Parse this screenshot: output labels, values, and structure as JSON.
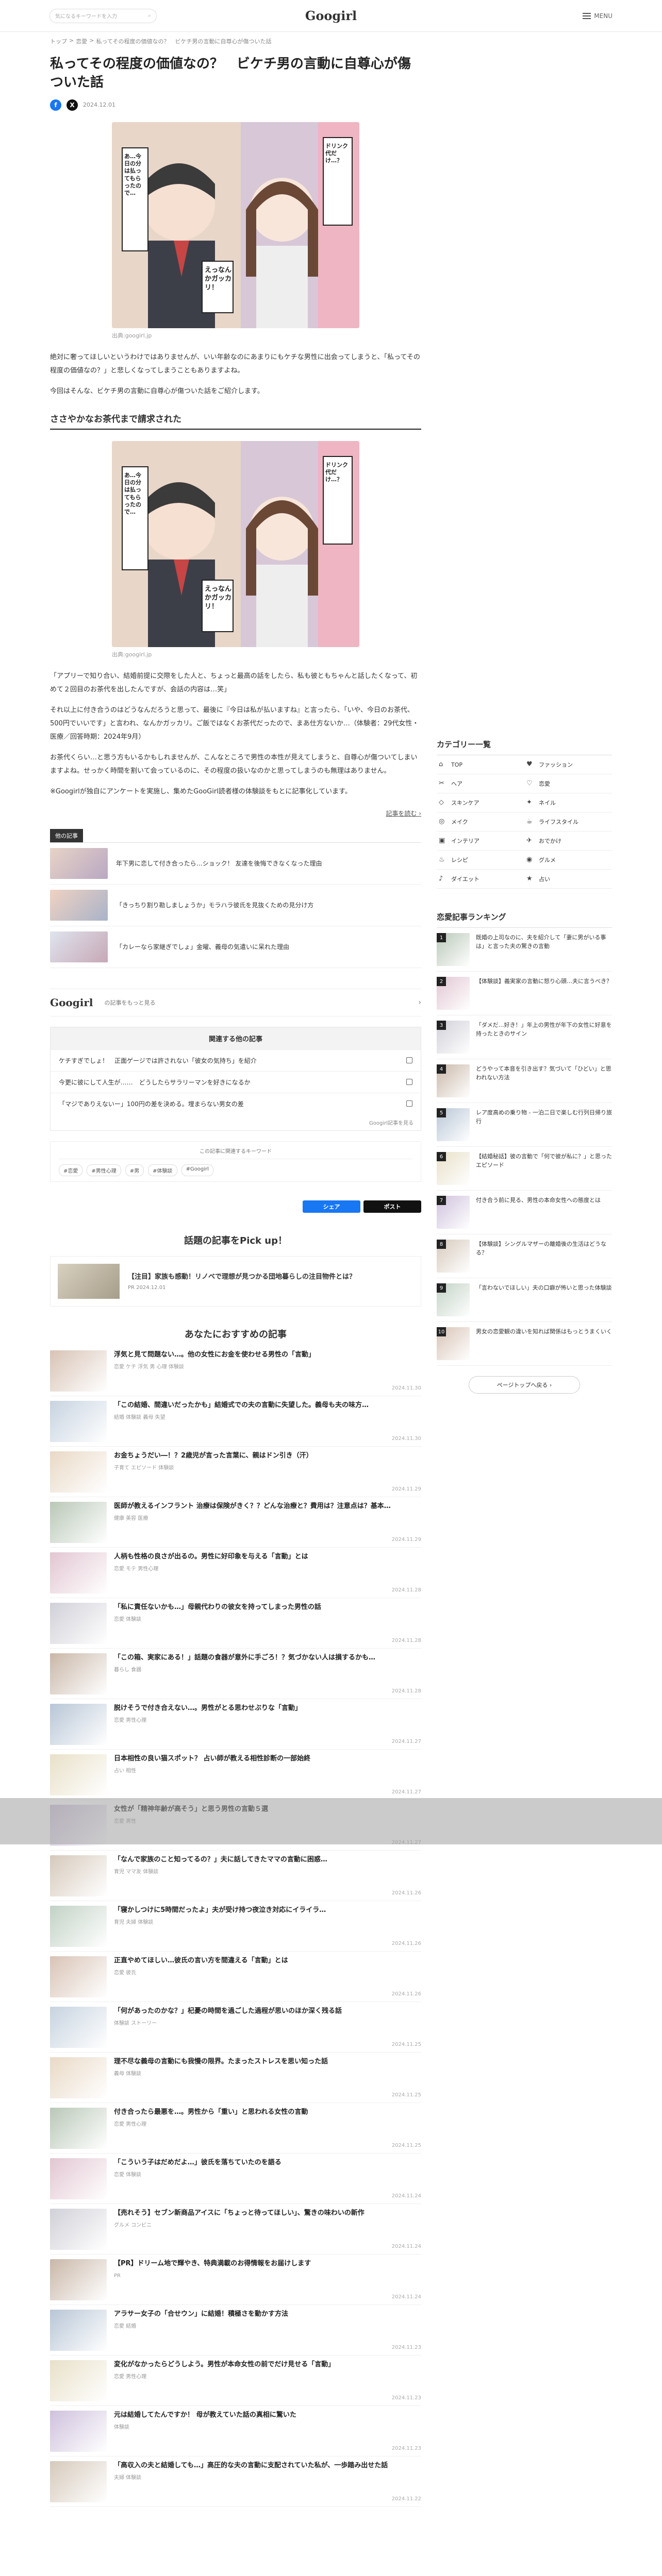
{
  "header": {
    "search_placeholder": "気になるキーワードを入力",
    "logo": "Googirl",
    "menu_label": "MENU"
  },
  "breadcrumb": [
    "トップ",
    ">",
    "恋愛",
    ">",
    "私ってその程度の価値なの？　ビケチ男の言動に自尊心が傷ついた話"
  ],
  "article": {
    "title": "私ってその程度の価値なの？　ビケチ男の言動に自尊心が傷ついた話",
    "date": "2024.12.01",
    "fb": "f",
    "x": "X",
    "image_caption": "出典:googirl.jp",
    "image_texts": [
      "あ…今日の分は払ってもらったので…",
      "えっなんかガッカリ！",
      "ドリンク代だけ…？"
    ],
    "intro": [
      "絶対に奢ってほしいというわけではありませんが、いい年齢なのにあまりにもケチな男性に出会ってしまうと、「私ってその程度の価値なの？」と悲しくなってしまうこともありますよね。",
      "今回はそんな、ビケチ男の言動に自尊心が傷ついた話をご紹介します。"
    ],
    "section_title": "ささやかなお茶代まで請求された",
    "section_caption": "出典:googirl.jp",
    "section_text": [
      "「アプリーで知り合い、結婚前提に交際をした人と、ちょっと最高の話をしたら、私も彼ともちゃんと話したくなって、初めて２回目のお茶代を出したんですが、会話の内容は…笑」",
      "それ以上に付き合うのはどうなんだろうと思って、最後に『今日は私が払いますね』と言ったら、「いや、今日のお茶代、500円でいいです」と言われ、なんかガッカリ。ご飯ではなくお茶代だったので、まあ仕方ないか…（体験者：29代女性・医療／回答時期：2024年9月）",
      "お茶代くらい…と思う方もいるかもしれませんが、こんなところで男性の本性が見えてしまうと、自尊心が傷ついてしまいますよね。せっかく時間を割いて会っているのに、その程度の扱いなのかと思ってしまうのも無理はありません。",
      "※Googirlが独自にアンケートを実施し、集めたGooGirl読者様の体験談をもとに記事化しています。"
    ],
    "source_link": "記事を読む ›",
    "related_head": "他の記事",
    "related": [
      "年下男に恋して付き合ったら…ショック！ 友達を後悔できなくなった理由",
      "「きっちり割り勘しましょうか」モラハラ彼氏を見抜くための見分け方",
      "「カレーなら家継ぎでしょ」金曜、義母の気遣いに呆れた理由"
    ]
  },
  "brand": {
    "logo": "Googirl",
    "text": "の記事をもっと見る",
    "arrow": "›"
  },
  "more": {
    "head": "関連する他の記事",
    "rows": [
      "ケチすぎでしょ！　正面ゲージでは許されない「彼女の気持ち」を紹介",
      "今更に彼にして人生が……　どうしたらサラリーマンを好きになるか",
      "「マジでありえないー」100円の差を決める。埋まらない男女の差"
    ],
    "foot": "Googirl記事を見る"
  },
  "tags": {
    "label": "この記事に関連するキーワード",
    "items": [
      "#恋愛",
      "#男性心理",
      "#男",
      "#体験談",
      "#Googirl"
    ]
  },
  "share": {
    "fb": "シェア",
    "x": "ポスト"
  },
  "pick": {
    "title": "話題の記事をPick up！",
    "card_title": "【注目】家族も感動！リノベで理想が見つかる団地暮らしの注目物件とは？",
    "card_date": "PR 2024.12.01"
  },
  "reco": {
    "title": "あなたにおすすめの記事",
    "items": [
      {
        "t": "浮気と見て問題ない…。他の女性にお金を使わせる男性の「言動」",
        "s": "恋愛 ケチ 浮気 男 心理 体験談",
        "d": "2024.11.30"
      },
      {
        "t": "「この結婚、間違いだったかも」結婚式での夫の言動に失望した。義母も夫の味方…",
        "s": "結婚 体験談 義母 失望",
        "d": "2024.11.30"
      },
      {
        "t": "お金ちょうだい―！？2歳児が言った言葉に、親はドン引き（汗）",
        "s": "子育て エピソード 体験談",
        "d": "2024.11.29"
      },
      {
        "t": "医師が教えるインフラント 治療は保険がきく？？どんな治療と？費用は？注意点は？基本…",
        "s": "健康 美容 医療",
        "d": "2024.11.29"
      },
      {
        "t": "人柄も性格の良さが出るの。男性に好印象を与える「言動」とは",
        "s": "恋愛 モテ 男性心理",
        "d": "2024.11.28"
      },
      {
        "t": "「私に責任ないかも…」母親代わりの彼女を持ってしまった男性の話",
        "s": "恋愛 体験談",
        "d": "2024.11.28"
      },
      {
        "t": "「この箱、実家にある！」話題の食器が意外に手ごろ！？気づかない人は損するかも…",
        "s": "暮らし 食器",
        "d": "2024.11.28"
      },
      {
        "t": "脱けそうで付き合えない…。男性がとる思わせぶりな「言動」",
        "s": "恋愛 男性心理",
        "d": "2024.11.27"
      },
      {
        "t": "日本相性の良い猫スポット？ 占い師が教える相性診断の一部始終",
        "s": "占い 相性",
        "d": "2024.11.27"
      },
      {
        "t": "女性が「精神年齢が高そう」と思う男性の言動５選",
        "s": "恋愛 男性",
        "d": "2024.11.27"
      },
      {
        "t": "「なんで家族のこと知ってるの？」夫に話してきたママの言動に困惑…",
        "s": "育児 ママ友 体験談",
        "d": "2024.11.26"
      },
      {
        "t": "「寝かしつけに5時間だったよ」夫が受け持つ夜泣き対応にイライラ…",
        "s": "育児 夫婦 体験談",
        "d": "2024.11.26"
      },
      {
        "t": "正直やめてほしい…彼氏の言い方を間違える「言動」とは",
        "s": "恋愛 彼氏",
        "d": "2024.11.26"
      },
      {
        "t": "「何があったのかな？」杞憂の時間を過ごした過程が思いのほか深く残る話",
        "s": "体験談 ストーリー",
        "d": "2024.11.25"
      },
      {
        "t": "理不尽な義母の言動にも我慢の限界。たまったストレスを思い知った話",
        "s": "義母 体験談",
        "d": "2024.11.25"
      },
      {
        "t": "付き合ったら最悪を…。男性から「重い」と思われる女性の言動",
        "s": "恋愛 男性心理",
        "d": "2024.11.25"
      },
      {
        "t": "「こういう子はだめだよ…」彼氏を落ちていたのを語る",
        "s": "恋愛 体験談",
        "d": "2024.11.24"
      },
      {
        "t": "【売れそう】セブン新商品アイスに「ちょっと待ってほしい」、驚きの味わいの新作",
        "s": "グルメ コンビニ",
        "d": "2024.11.24"
      },
      {
        "t": "【PR】ドリーム地で輝やき、特典満載のお得情報をお届けします",
        "s": "PR",
        "d": "2024.11.24"
      },
      {
        "t": "アラサー女子の「合せウン」に結婚！積極さを動かす方法",
        "s": "恋愛 結婚",
        "d": "2024.11.23"
      },
      {
        "t": "変化がなかったらどうしよう。男性が本命女性の前でだけ見せる「言動」",
        "s": "恋愛 男性心理",
        "d": "2024.11.23"
      },
      {
        "t": "元は結婚してたんですか！ 母が教えていた話の真相に驚いた",
        "s": "体験談",
        "d": "2024.11.23"
      },
      {
        "t": "「高収入の夫と結婚しても…」高圧的な夫の言動に支配されていた私が、一歩踏み出せた話",
        "s": "夫婦 体験談",
        "d": "2024.11.22"
      }
    ]
  },
  "sidebar": {
    "categories_title": "カテゴリー一覧",
    "categories": [
      {
        "label": "TOP",
        "icon": "⌂"
      },
      {
        "label": "ファッション",
        "icon": "♥"
      },
      {
        "label": "ヘア",
        "icon": "✂"
      },
      {
        "label": "恋愛",
        "icon": "♡"
      },
      {
        "label": "スキンケア",
        "icon": "◇"
      },
      {
        "label": "ネイル",
        "icon": "✦"
      },
      {
        "label": "メイク",
        "icon": "◎"
      },
      {
        "label": "ライフスタイル",
        "icon": "☕"
      },
      {
        "label": "インテリア",
        "icon": "▣"
      },
      {
        "label": "おでかけ",
        "icon": "✈"
      },
      {
        "label": "レシピ",
        "icon": "♨"
      },
      {
        "label": "グルメ",
        "icon": "◉"
      },
      {
        "label": "ダイエット",
        "icon": "♪"
      },
      {
        "label": "占い",
        "icon": "★"
      }
    ],
    "ranking_title": "恋愛記事ランキング",
    "ranking": [
      "既婚の上司なのに、夫を紹介して「妻に男がいる事は」と言った夫の驚きの言動",
      "【体験談】義実家の言動に怒り心頭…夫に言うべき？",
      "「ダメだ…好き！」年上の男性が年下の女性に好意を持ったときのサイン",
      "どうやって本音を引き出す？気づいて「ひどい」と思われない方法",
      "レア度高めの乗り物 - 一泊二日で楽しむ行列日帰り旅行",
      "【結婚秘話】彼の言動で「何で彼が私に？」と思ったエピソード",
      "付き合う前に見る、男性の本命女性への態度とは",
      "【体験談】シングルマザーの離婚後の生活はどうなる？",
      "「言わないでほしい」夫の口癖が怖いと思った体験談",
      "男女の恋愛観の違いを知れば関係はもっとうまくいく"
    ],
    "ranking_more": "ページトップへ戻る ›"
  },
  "colors": {
    "accent": "#222222",
    "facebook": "#1877f2",
    "x": "#111111"
  }
}
